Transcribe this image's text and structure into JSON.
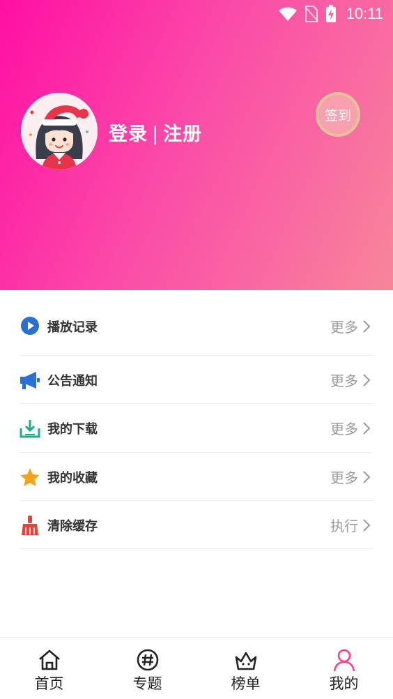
{
  "status_bar": {
    "time": "10:11"
  },
  "profile": {
    "login_label": "登录",
    "separator": "|",
    "register_label": "注册",
    "checkin_label": "签到"
  },
  "menu": {
    "items": [
      {
        "label": "播放记录",
        "action": "更多",
        "icon": "play-circle-icon",
        "icon_color": "#2a6fd6"
      },
      {
        "label": "公告通知",
        "action": "更多",
        "icon": "megaphone-icon",
        "icon_color": "#2a6fd6"
      },
      {
        "label": "我的下载",
        "action": "更多",
        "icon": "download-tray-icon",
        "icon_color": "#1fae8a"
      },
      {
        "label": "我的收藏",
        "action": "更多",
        "icon": "star-icon",
        "icon_color": "#f5a21b"
      },
      {
        "label": "清除缓存",
        "action": "执行",
        "icon": "broom-icon",
        "icon_color": "#e6413b"
      }
    ]
  },
  "tabbar": {
    "tabs": [
      {
        "label": "首页",
        "icon": "home-icon"
      },
      {
        "label": "专题",
        "icon": "hashtag-icon"
      },
      {
        "label": "榜单",
        "icon": "crown-icon"
      },
      {
        "label": "我的",
        "icon": "user-icon",
        "active": true
      }
    ],
    "active_color": "#ff3c8e"
  },
  "colors": {
    "header_gradient_start": "#ff0fa3",
    "header_gradient_end": "#f7869a",
    "checkin_fill": "#f8a0ad",
    "checkin_border": "#e6c19a"
  }
}
